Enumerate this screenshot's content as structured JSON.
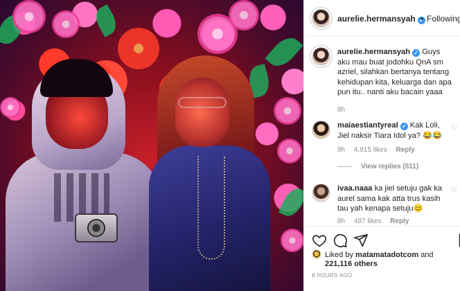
{
  "post": {
    "author": "aurelie.hermansyah",
    "follow_separator": "•",
    "follow_label": "Following"
  },
  "caption": {
    "username": "aurelie.hermansyah",
    "text": "Guys aku mau buat jodohku QnA sm azriel, silahkan bertanya tentang kehidupan kita, keluarga dan apa pun itu.. nanti aku bacain yaaa",
    "time": "8h"
  },
  "comments": [
    {
      "username": "maiaestiantyreal",
      "text": "Kak Loli, Jiel naksir Tiara Idol ya? 😂😂",
      "time": "8h",
      "likes": "4,915 likes",
      "reply_label": "Reply",
      "view_replies": "View replies (511)"
    },
    {
      "username": "ivaa.naaa",
      "text": "ka jiel setuju gak ka aurel sama kak atta trus kasih tau yah kenapa setuju😊",
      "time": "8h",
      "likes": "487 likes",
      "reply_label": "Reply"
    }
  ],
  "likes": {
    "prefix": "Liked by",
    "liker": "matamatadotcom",
    "conjunction": "and",
    "count": "221,116 others"
  },
  "timestamp": "8 HOURS AGO",
  "icons": {
    "verified": "verified-badge-icon",
    "heart": "heart-icon",
    "comment": "comment-icon",
    "share": "share-icon",
    "save": "bookmark-icon"
  },
  "colors": {
    "verified_blue": "#3897f0",
    "meta_gray": "#8e8e8e",
    "text": "#262626"
  }
}
